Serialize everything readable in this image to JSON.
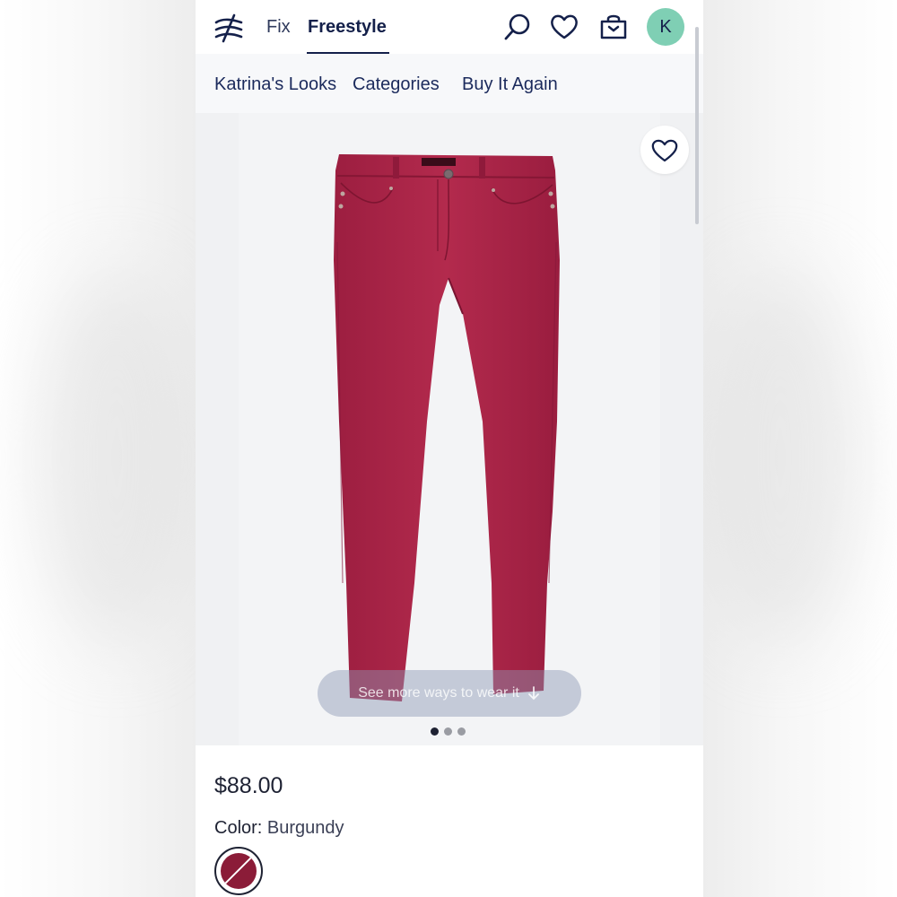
{
  "nav": {
    "tabs": [
      {
        "label": "Fix"
      },
      {
        "label": "Freestyle",
        "active": true
      }
    ],
    "avatar_initial": "K"
  },
  "subnav": {
    "items": [
      "Katrina's Looks",
      "Categories",
      "Buy It Again"
    ]
  },
  "product": {
    "see_more_label": "See more ways to wear it",
    "price": "$88.00",
    "color_label": "Color:",
    "color_value": "Burgundy",
    "carousel": {
      "count": 3,
      "active_index": 0
    }
  },
  "colors": {
    "navy": "#14204a",
    "burgundy": "#8b1c38",
    "avatar": "#7fcfb4"
  }
}
